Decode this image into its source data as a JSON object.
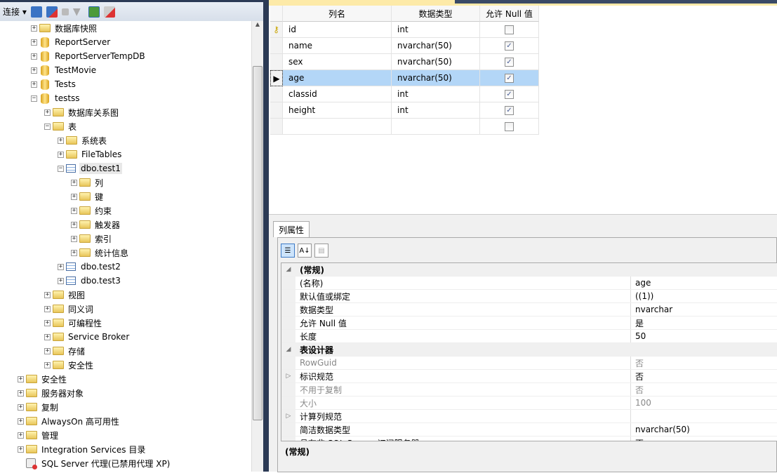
{
  "toolbar": {
    "connect": "连接"
  },
  "tree": [
    {
      "label": "数据库快照",
      "level": 1,
      "exp": "+",
      "icon": "folder"
    },
    {
      "label": "ReportServer",
      "level": 1,
      "exp": "+",
      "icon": "db"
    },
    {
      "label": "ReportServerTempDB",
      "level": 1,
      "exp": "+",
      "icon": "db"
    },
    {
      "label": "TestMovie",
      "level": 1,
      "exp": "+",
      "icon": "db"
    },
    {
      "label": "Tests",
      "level": 1,
      "exp": "+",
      "icon": "db"
    },
    {
      "label": "testss",
      "level": 1,
      "exp": "-",
      "icon": "db"
    },
    {
      "label": "数据库关系图",
      "level": 2,
      "exp": "+",
      "icon": "folder"
    },
    {
      "label": "表",
      "level": 2,
      "exp": "-",
      "icon": "folder"
    },
    {
      "label": "系统表",
      "level": 3,
      "exp": "+",
      "icon": "folder"
    },
    {
      "label": "FileTables",
      "level": 3,
      "exp": "+",
      "icon": "folder"
    },
    {
      "label": "dbo.test1",
      "level": 3,
      "exp": "-",
      "icon": "table",
      "selected": true
    },
    {
      "label": "列",
      "level": 4,
      "exp": "+",
      "icon": "folder"
    },
    {
      "label": "键",
      "level": 4,
      "exp": "+",
      "icon": "folder"
    },
    {
      "label": "约束",
      "level": 4,
      "exp": "+",
      "icon": "folder"
    },
    {
      "label": "触发器",
      "level": 4,
      "exp": "+",
      "icon": "folder"
    },
    {
      "label": "索引",
      "level": 4,
      "exp": "+",
      "icon": "folder"
    },
    {
      "label": "统计信息",
      "level": 4,
      "exp": "+",
      "icon": "folder"
    },
    {
      "label": "dbo.test2",
      "level": 3,
      "exp": "+",
      "icon": "table"
    },
    {
      "label": "dbo.test3",
      "level": 3,
      "exp": "+",
      "icon": "table"
    },
    {
      "label": "视图",
      "level": 2,
      "exp": "+",
      "icon": "folder"
    },
    {
      "label": "同义词",
      "level": 2,
      "exp": "+",
      "icon": "folder"
    },
    {
      "label": "可编程性",
      "level": 2,
      "exp": "+",
      "icon": "folder"
    },
    {
      "label": "Service Broker",
      "level": 2,
      "exp": "+",
      "icon": "folder"
    },
    {
      "label": "存储",
      "level": 2,
      "exp": "+",
      "icon": "folder"
    },
    {
      "label": "安全性",
      "level": 2,
      "exp": "+",
      "icon": "folder"
    },
    {
      "label": "安全性",
      "level": 0,
      "exp": "+",
      "icon": "folder"
    },
    {
      "label": "服务器对象",
      "level": 0,
      "exp": "+",
      "icon": "folder"
    },
    {
      "label": "复制",
      "level": 0,
      "exp": "+",
      "icon": "folder"
    },
    {
      "label": "AlwaysOn 高可用性",
      "level": 0,
      "exp": "+",
      "icon": "folder"
    },
    {
      "label": "管理",
      "level": 0,
      "exp": "+",
      "icon": "folder"
    },
    {
      "label": "Integration Services 目录",
      "level": 0,
      "exp": "+",
      "icon": "folder"
    },
    {
      "label": "SQL Server 代理(已禁用代理 XP)",
      "level": 0,
      "exp": "",
      "icon": "agent"
    }
  ],
  "grid": {
    "headers": [
      "列名",
      "数据类型",
      "允许 Null 值"
    ],
    "rows": [
      {
        "name": "id",
        "type": "int",
        "nullable": false,
        "key": true
      },
      {
        "name": "name",
        "type": "nvarchar(50)",
        "nullable": true
      },
      {
        "name": "sex",
        "type": "nvarchar(50)",
        "nullable": true
      },
      {
        "name": "age",
        "type": "nvarchar(50)",
        "nullable": true,
        "current": true
      },
      {
        "name": "classid",
        "type": "int",
        "nullable": true
      },
      {
        "name": "height",
        "type": "int",
        "nullable": true
      },
      {
        "name": "",
        "type": "",
        "nullable": false
      }
    ]
  },
  "properties": {
    "tab": "列属性",
    "rows": [
      {
        "k": "(常规)",
        "v": "",
        "cat": true,
        "m": "◢"
      },
      {
        "k": "(名称)",
        "v": "age"
      },
      {
        "k": "默认值或绑定",
        "v": "((1))"
      },
      {
        "k": "数据类型",
        "v": "nvarchar"
      },
      {
        "k": "允许 Null 值",
        "v": "是"
      },
      {
        "k": "长度",
        "v": "50"
      },
      {
        "k": "表设计器",
        "v": "",
        "cat": true,
        "m": "◢"
      },
      {
        "k": "RowGuid",
        "v": "否",
        "dim": true
      },
      {
        "k": "标识规范",
        "v": "否",
        "m": "▷"
      },
      {
        "k": "不用于复制",
        "v": "否",
        "dim": true
      },
      {
        "k": "大小",
        "v": "100",
        "dim": true
      },
      {
        "k": "计算列规范",
        "v": "",
        "m": "▷"
      },
      {
        "k": "简洁数据类型",
        "v": "nvarchar(50)"
      },
      {
        "k": "具有非 SQL Server 订阅服务器",
        "v": "否"
      }
    ],
    "description": "(常规)"
  }
}
